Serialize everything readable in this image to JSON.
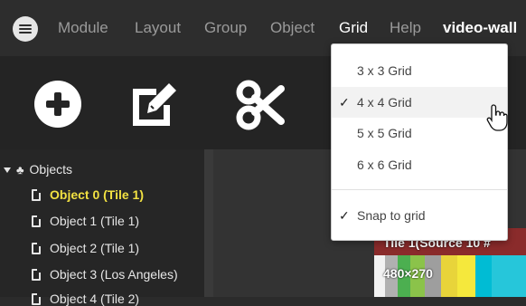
{
  "menubar": {
    "items": [
      {
        "label": "Module"
      },
      {
        "label": "Layout"
      },
      {
        "label": "Group"
      },
      {
        "label": "Object"
      },
      {
        "label": "Grid"
      },
      {
        "label": "Help"
      }
    ],
    "app_name": "video-wall"
  },
  "toolbar": {
    "icons": [
      "add-circle-icon",
      "edit-icon",
      "scissors-icon"
    ]
  },
  "grid_menu": {
    "items": [
      {
        "label": "3 x 3 Grid",
        "checked": false
      },
      {
        "label": "4 x 4 Grid",
        "checked": true
      },
      {
        "label": "5 x 5 Grid",
        "checked": false
      },
      {
        "label": "6 x 6 Grid",
        "checked": false
      }
    ],
    "snap": {
      "label": "Snap to grid",
      "checked": true
    },
    "check_mark": "✓"
  },
  "tree": {
    "root_label": "Objects",
    "items": [
      {
        "label": "Object 0 (Tile 1)",
        "selected": true
      },
      {
        "label": "Object 1 (Tile 1)",
        "selected": false
      },
      {
        "label": "Object 2 (Tile 1)",
        "selected": false
      },
      {
        "label": "Object 3 (Los Angeles)",
        "selected": false
      },
      {
        "label": "Object 4 (Tile 2)",
        "selected": false
      }
    ]
  },
  "preview": {
    "title": "Tile 1(Source 10 #",
    "resolution": "480×270"
  },
  "colors": {
    "menubar_bg": "#2d2d2d",
    "menu_text": "#9a9a9a",
    "menu_active": "#ffffff",
    "selected_item": "#f2e142",
    "dropdown_bg": "#ffffff"
  }
}
